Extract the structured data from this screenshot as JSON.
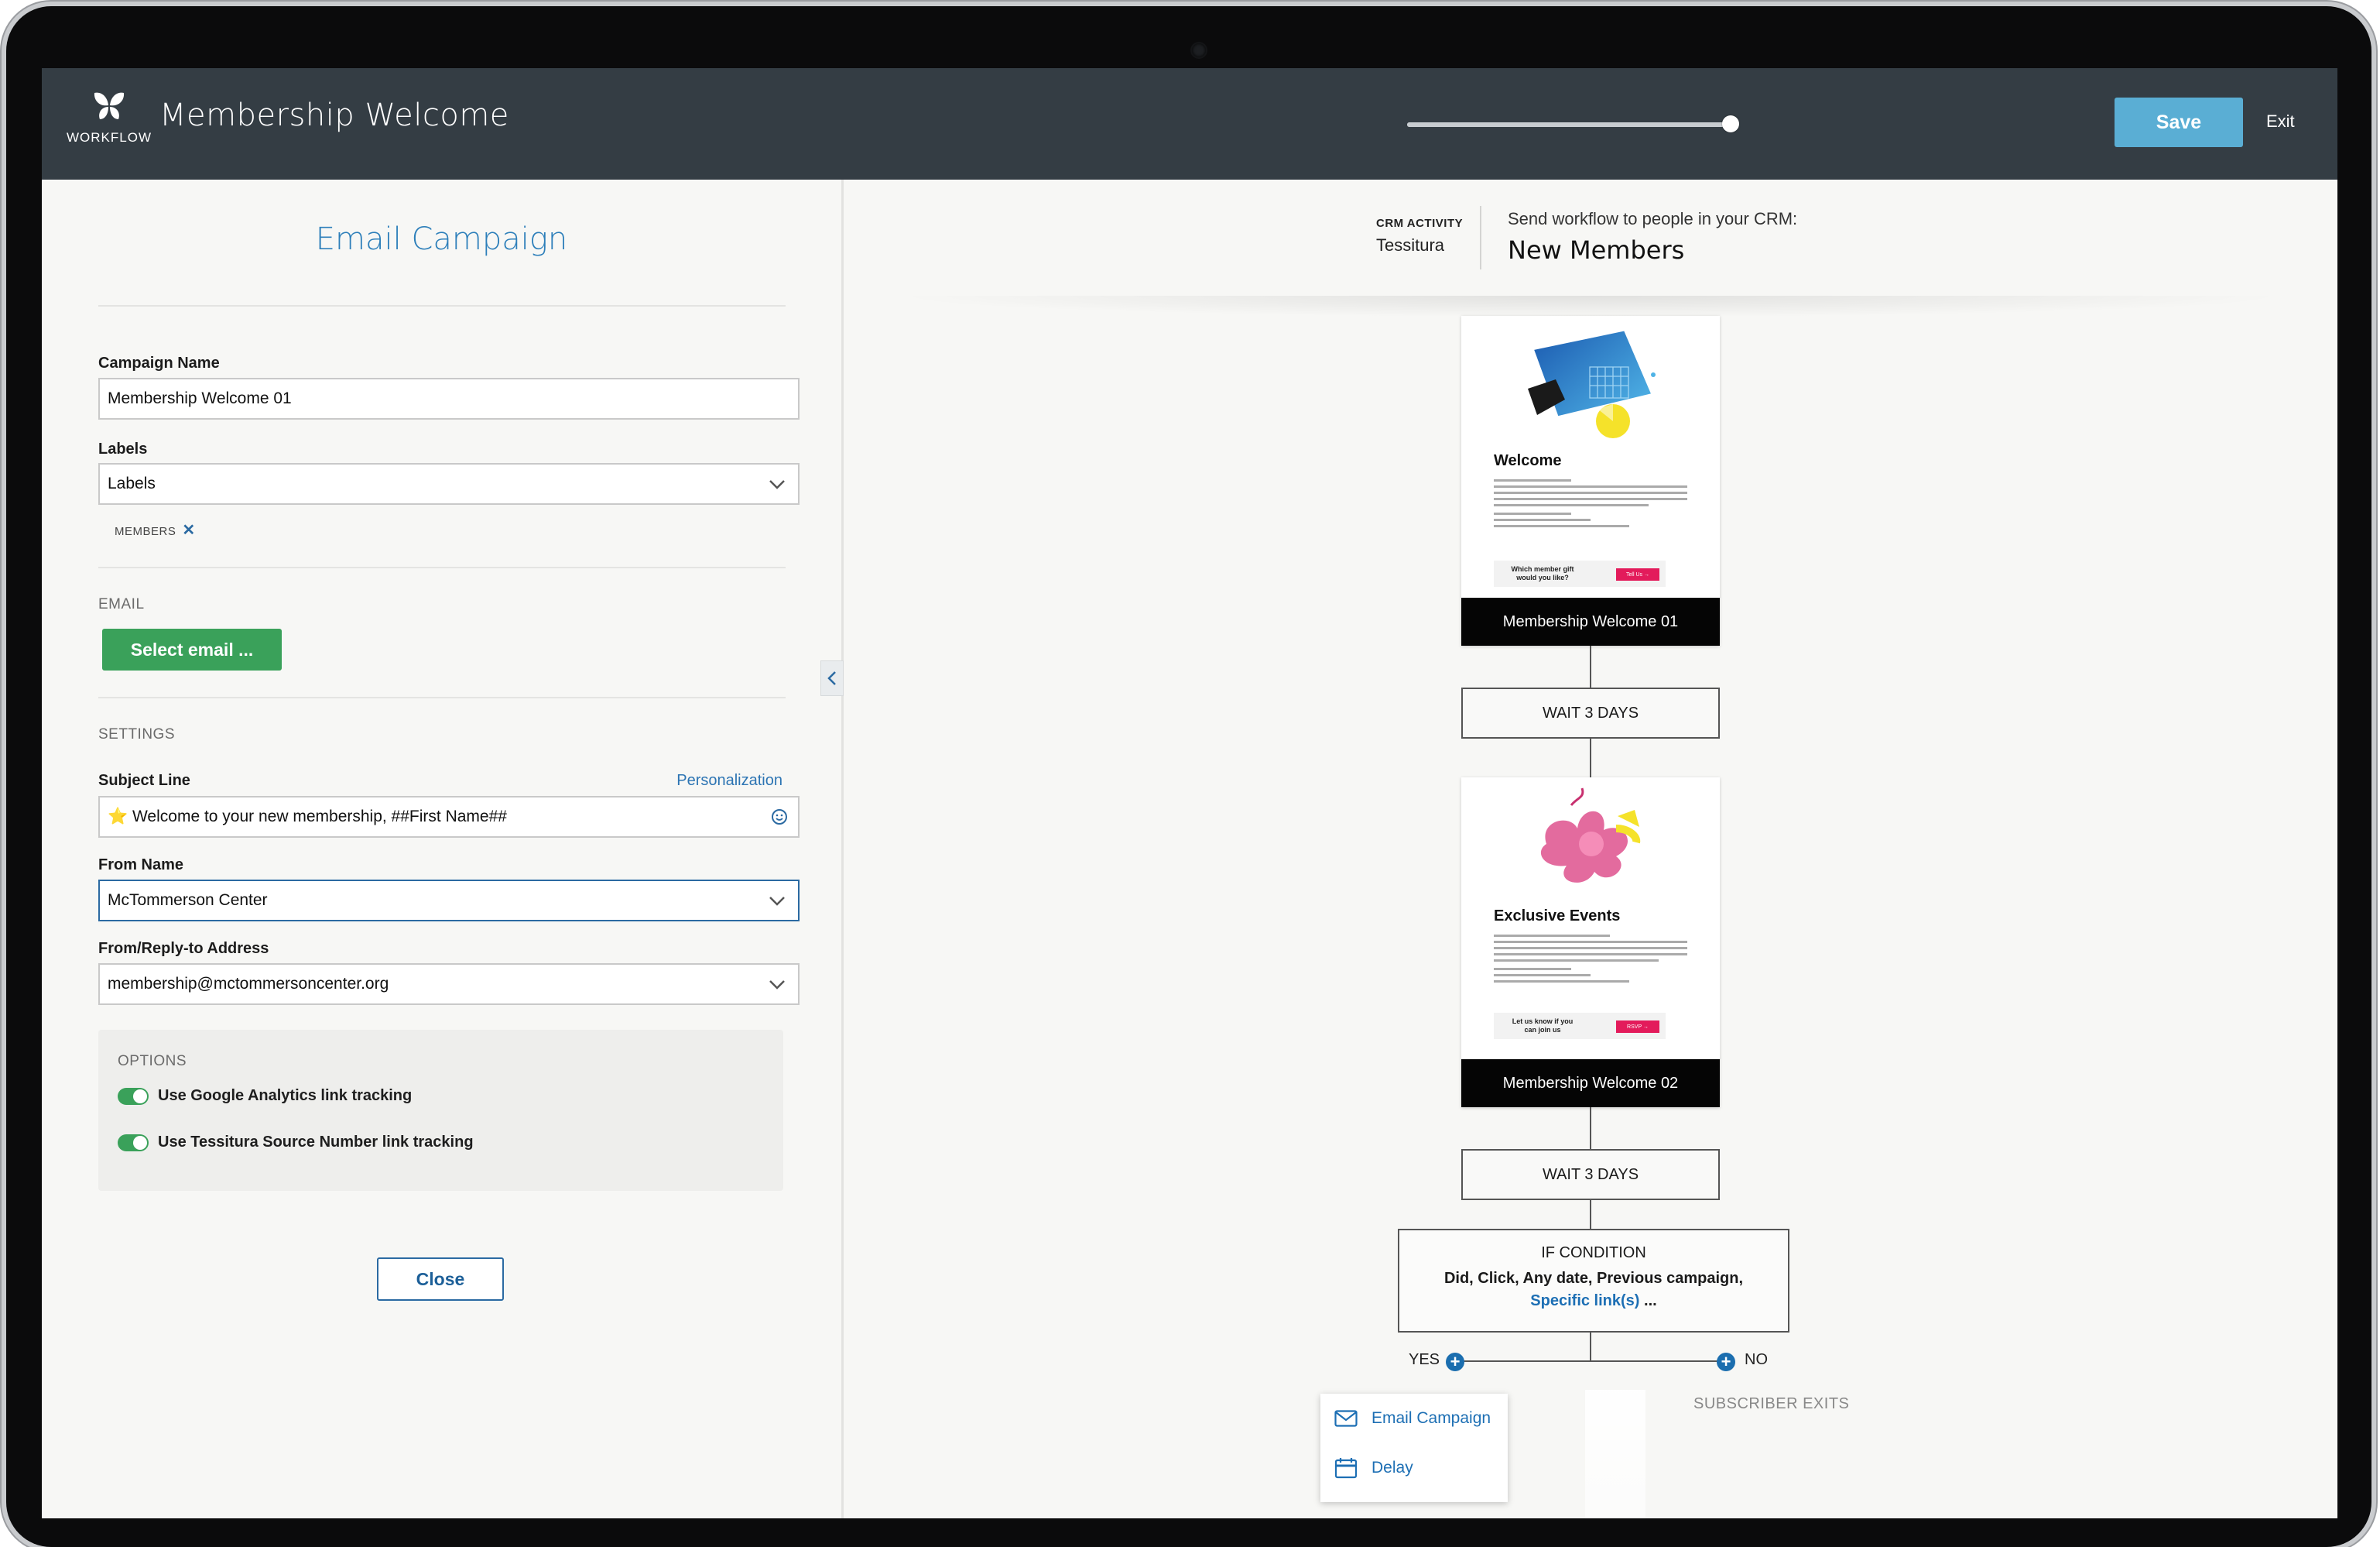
{
  "app": {
    "logo_label": "WORKFLOW",
    "title": "Membership Welcome",
    "progress": 1.0,
    "save_label": "Save",
    "exit_label": "Exit"
  },
  "panel": {
    "title": "Email Campaign",
    "campaign_name_label": "Campaign Name",
    "campaign_name_value": "Membership Welcome 01",
    "labels_label": "Labels",
    "labels_value": "Labels",
    "tags": [
      "MEMBERS"
    ],
    "email_section": "EMAIL",
    "select_email_label": "Select email ...",
    "settings_section": "SETTINGS",
    "subject_label": "Subject Line",
    "personalization_label": "Personalization",
    "subject_value": "⭐ Welcome to your new membership, ##First Name##",
    "from_name_label": "From Name",
    "from_name_value": "McTommerson Center",
    "reply_label": "From/Reply-to Address",
    "reply_value": "membership@mctommersoncenter.org",
    "options_section": "OPTIONS",
    "options": [
      {
        "label": "Use Google Analytics link tracking",
        "enabled": true
      },
      {
        "label": "Use Tessitura Source Number link tracking",
        "enabled": true
      }
    ],
    "close_label": "Close"
  },
  "canvas": {
    "crm_activity_label": "CRM ACTIVITY",
    "crm_activity_value": "Tessitura",
    "send_text": "Send workflow to people in your CRM:",
    "group_name": "New Members",
    "emails": [
      {
        "heading": "Welcome",
        "cta": "Which member gift would you like?",
        "cta_button": "Tell Us →",
        "footer": "Membership Welcome 01"
      },
      {
        "heading": "Exclusive Events",
        "cta": "Let us know if you can join us",
        "cta_button": "RSVP →",
        "footer": "Membership Welcome 02"
      }
    ],
    "waits": [
      "WAIT 3 DAYS",
      "WAIT 3 DAYS"
    ],
    "condition": {
      "title": "IF CONDITION",
      "line1": "Did, Click, Any date, Previous campaign,",
      "link": "Specific link(s)",
      "suffix": " ..."
    },
    "yes_label": "YES",
    "no_label": "NO",
    "exits_label": "SUBSCRIBER EXITS",
    "menu": [
      "Email Campaign",
      "Delay"
    ]
  },
  "colors": {
    "topbar": "#343d44",
    "accent": "#5aaed4",
    "link": "#1d6fb4",
    "success": "#3aa15a",
    "cta": "#e31b5b"
  },
  "icons": [
    "butterfly-logo-icon",
    "chevron-down-icon",
    "smiley-icon",
    "close-x-icon",
    "chevron-left-icon",
    "plus-icon",
    "envelope-icon",
    "calendar-icon"
  ]
}
